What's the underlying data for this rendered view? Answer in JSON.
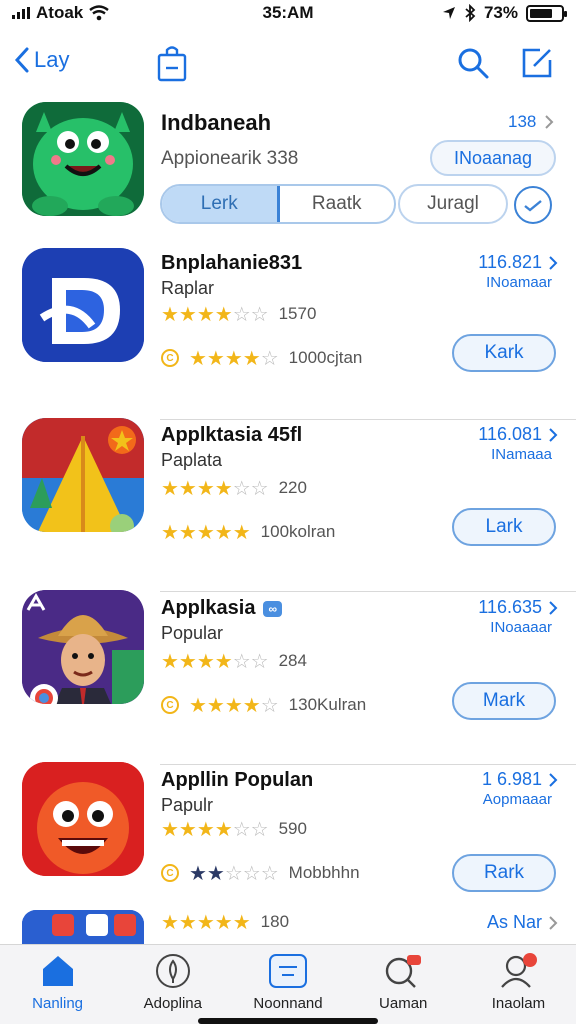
{
  "status": {
    "carrier": "Atoak",
    "time": "35:AM",
    "battery": "73%"
  },
  "nav": {
    "back_label": "Lay"
  },
  "featured": {
    "title": "Indbaneah",
    "subtitle": "Appionearik 338",
    "rank": "138",
    "get_label": "INoaanag",
    "segments": [
      "Lerk",
      "Raatk"
    ],
    "extra_segment": "Juragl"
  },
  "apps": [
    {
      "name": "Bnplahanie831",
      "category": "Raplar",
      "rank": "116.821",
      "sub": "INoamaar",
      "rating_text": "1570",
      "reviews_text": "1000cjtan",
      "button": "Kark",
      "colors": [
        "#1d3fb3",
        "#2d63e0"
      ]
    },
    {
      "name": "Applktasia 45fl",
      "category": "Paplata",
      "rank": "116.081",
      "sub": "INamaaa",
      "rating_text": "220",
      "reviews_text": "100kolran",
      "button": "Lark",
      "colors": [
        "#c22b2b",
        "#2a7bd6"
      ]
    },
    {
      "name": "Applkasia",
      "category": "Popular",
      "rank": "116.635",
      "sub": "INoaaaar",
      "rating_text": "284",
      "reviews_text": "130Kulran",
      "button": "Mark",
      "colors": [
        "#4a2a86",
        "#2c9d5b"
      ]
    },
    {
      "name": "Appllin Populan",
      "category": "Papulr",
      "rank": "1 6.981",
      "sub": "Aopmaaar",
      "rating_text": "590",
      "reviews_text": "Mobbhhn",
      "button": "Rark",
      "colors": [
        "#d92020",
        "#f05a28"
      ]
    }
  ],
  "partial_row": {
    "rating_text": "180",
    "rank": "As Nar"
  },
  "tabs": [
    {
      "label": "Nanling",
      "icon": "house-icon"
    },
    {
      "label": "Adoplina",
      "icon": "feather-icon"
    },
    {
      "label": "Noonnand",
      "icon": "list-icon"
    },
    {
      "label": "Uaman",
      "icon": "search-icon"
    },
    {
      "label": "Inaolam",
      "icon": "person-icon"
    }
  ],
  "colors": {
    "accent": "#1a6fe0",
    "star": "#f2b619"
  }
}
